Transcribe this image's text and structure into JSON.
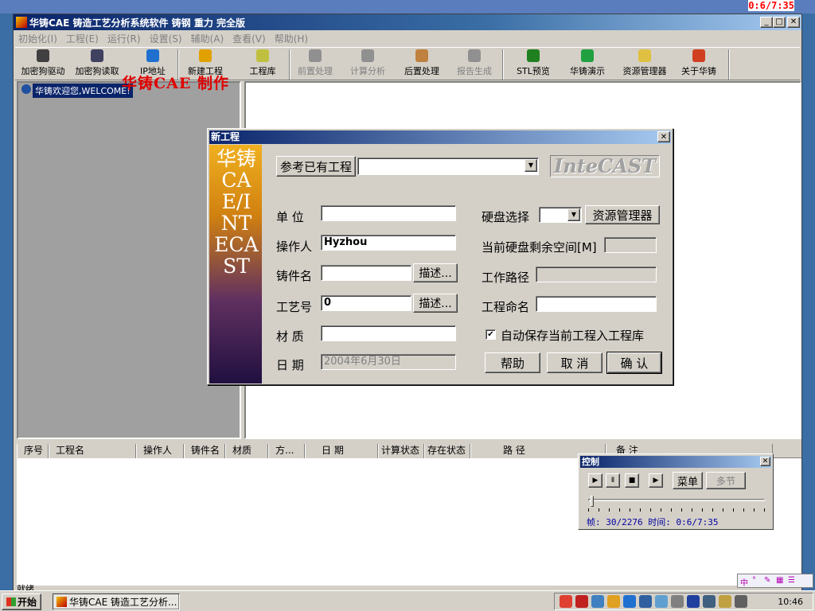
{
  "top_counter": "0:6/7:35",
  "window": {
    "title": "华铸CAE 铸造工艺分析系统软件  铸钢 重力 完全版"
  },
  "menu": [
    "初始化(I)",
    "工程(E)",
    "运行(R)",
    "设置(S)",
    "辅助(A)",
    "查看(V)",
    "帮助(H)"
  ],
  "toolbar": [
    {
      "label": "加密狗驱动",
      "icon": "dongle-driver-icon",
      "color": "#404040",
      "enabled": true
    },
    {
      "label": "加密狗读取",
      "icon": "dongle-read-icon",
      "color": "#404060",
      "enabled": true
    },
    {
      "label": "IP地址",
      "icon": "ie-icon",
      "color": "#2070d0",
      "enabled": true
    },
    {
      "label": "新建工程",
      "icon": "arrows-icon",
      "color": "#e0a000",
      "enabled": true
    },
    {
      "label": "工程库",
      "icon": "database-icon",
      "color": "#c0c040",
      "enabled": true
    },
    {
      "label": "前置处理",
      "icon": "preprocess-icon",
      "color": "#909090",
      "enabled": false
    },
    {
      "label": "计算分析",
      "icon": "compute-icon",
      "color": "#909090",
      "enabled": false
    },
    {
      "label": "后置处理",
      "icon": "postprocess-icon",
      "color": "#c08040",
      "enabled": true
    },
    {
      "label": "报告生成",
      "icon": "report-icon",
      "color": "#909090",
      "enabled": false
    },
    {
      "label": "STL预览",
      "icon": "tree-icon",
      "color": "#208020",
      "enabled": true
    },
    {
      "label": "华铸演示",
      "icon": "demo-icon",
      "color": "#20a040",
      "enabled": true
    },
    {
      "label": "资源管理器",
      "icon": "explorer-icon",
      "color": "#e0c040",
      "enabled": true
    },
    {
      "label": "关于华铸",
      "icon": "about-icon",
      "color": "#d04020",
      "enabled": true
    }
  ],
  "tree": {
    "item": "华铸欢迎您,WELCOME!"
  },
  "overlay": "华铸CAE  制作",
  "list": {
    "columns": [
      "序号",
      "工程名",
      "操作人",
      "铸件名",
      "材质",
      "方...",
      "日 期",
      "计算状态",
      "存在状态",
      "路 径",
      "备 注"
    ]
  },
  "statusbar": "就绪",
  "dialog": {
    "title": "新工程",
    "banner": "华铸CAE/INTECAST",
    "ref_label": "参考已有工程",
    "ref_value": "",
    "logo": "InteCAST",
    "unit_label": "单  位",
    "unit_value": "",
    "operator_label": "操作人",
    "operator_value": "Hyzhou",
    "casting_label": "铸件名",
    "casting_value": "",
    "process_label": "工艺号",
    "process_value": "0",
    "material_label": "材  质",
    "material_value": "",
    "date_label": "日  期",
    "date_value": "2004年6月30日",
    "describe": "描述...",
    "disk_label": "硬盘选择",
    "disk_value": "",
    "explorer_btn": "资源管理器",
    "space_label": "当前硬盘剩余空间[M]",
    "space_value": "",
    "path_label": "工作路径",
    "path_value": "",
    "name_label": "工程命名",
    "name_value": "",
    "autosave_label": "自动保存当前工程入工程库",
    "autosave_checked": "✔",
    "help_btn": "帮助",
    "cancel_btn": "取 消",
    "ok_btn": "确 认"
  },
  "control": {
    "title": "控制",
    "menu_btn": "菜单",
    "step_btn": "多节",
    "status": "帧: 30/2276 时间: 0:6/7:35",
    "frame_progress": 0.013
  },
  "taskbar": {
    "start": "开始",
    "app": "华铸CAE 铸造工艺分析...",
    "clock": "10:46"
  }
}
